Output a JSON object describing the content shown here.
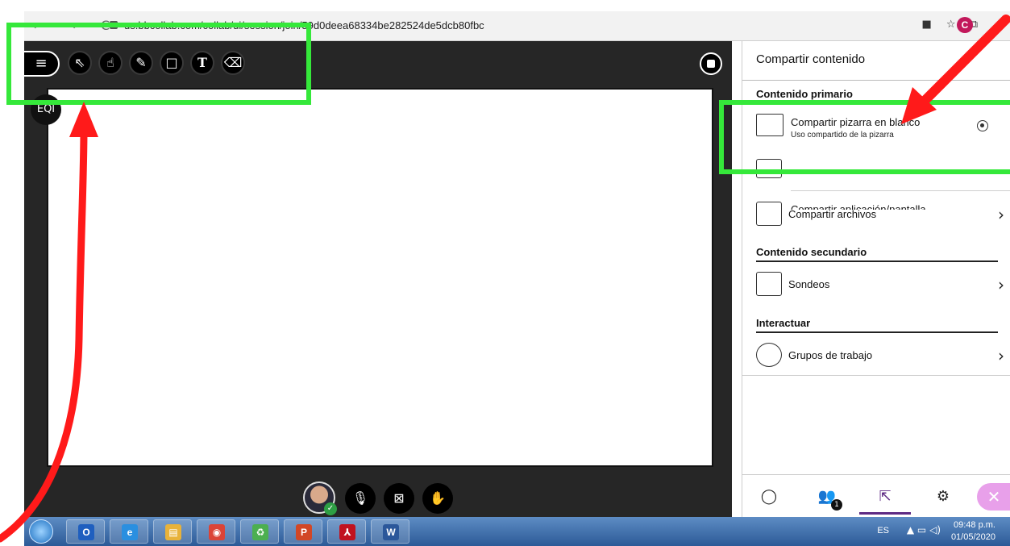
{
  "browser": {
    "url": "us.bbcollab.com/collab/ui/session/join/59d0deea68334be282524de5dcb80fbc",
    "nav": "← → C",
    "profile_initial": "C",
    "icons": [
      "video-icon",
      "star-icon",
      "cast-icon"
    ]
  },
  "toolbar": {
    "menu_label": "≡",
    "tools": [
      {
        "name": "select-tool",
        "glyph": "⇖"
      },
      {
        "name": "pan-tool",
        "glyph": "☝"
      },
      {
        "name": "pencil-tool",
        "glyph": "✎"
      },
      {
        "name": "shape-tool",
        "glyph": "□"
      },
      {
        "name": "text-tool",
        "glyph": "T"
      },
      {
        "name": "eraser-tool",
        "glyph": "⌫"
      }
    ]
  },
  "whiteboard": {
    "badge": "EQI"
  },
  "session_controls": {
    "mic": "🎙",
    "camera": "⊠",
    "hand": "✋"
  },
  "panel": {
    "title": "Compartir contenido",
    "primary_section": "Contenido primario",
    "whiteboard_item": {
      "label": "Compartir pizarra en blanco",
      "sublabel": "Uso compartido de la pizarra"
    },
    "app_item_label": "Compartir aplicación/pantalla",
    "files_item_label": "Compartir archivos",
    "secondary_section": "Contenido secundario",
    "polls_item_label": "Sondeos",
    "interact_section": "Interactuar",
    "groups_item_label": "Grupos de trabajo",
    "chevron": "›"
  },
  "panel_nav": {
    "chat": "◯",
    "attendees": "👥",
    "attendees_badge": "1",
    "share": "⇱",
    "settings": "⚙",
    "close": "✕"
  },
  "taskbar": {
    "apps": [
      {
        "name": "outlook-app",
        "glyph": "O",
        "color": "#1f5fbf"
      },
      {
        "name": "ie-app",
        "glyph": "e",
        "color": "#2a8fe0"
      },
      {
        "name": "explorer-app",
        "glyph": "▤",
        "color": "#e8b23a"
      },
      {
        "name": "chrome-app",
        "glyph": "◉",
        "color": "#db4437"
      },
      {
        "name": "recycle-app",
        "glyph": "♻",
        "color": "#4caf50"
      },
      {
        "name": "powerpoint-app",
        "glyph": "P",
        "color": "#d24726"
      },
      {
        "name": "acrobat-app",
        "glyph": "⅄",
        "color": "#c1121f"
      },
      {
        "name": "word-app",
        "glyph": "W",
        "color": "#2b579a"
      }
    ],
    "lang": "ES",
    "tray": "▲ ▭ ◁)",
    "time": "09:48 p.m.",
    "date": "01/05/2020"
  },
  "colors": {
    "highlight": "#35e83a",
    "arrow": "#ff1a1a",
    "accent": "#5e2a84"
  }
}
